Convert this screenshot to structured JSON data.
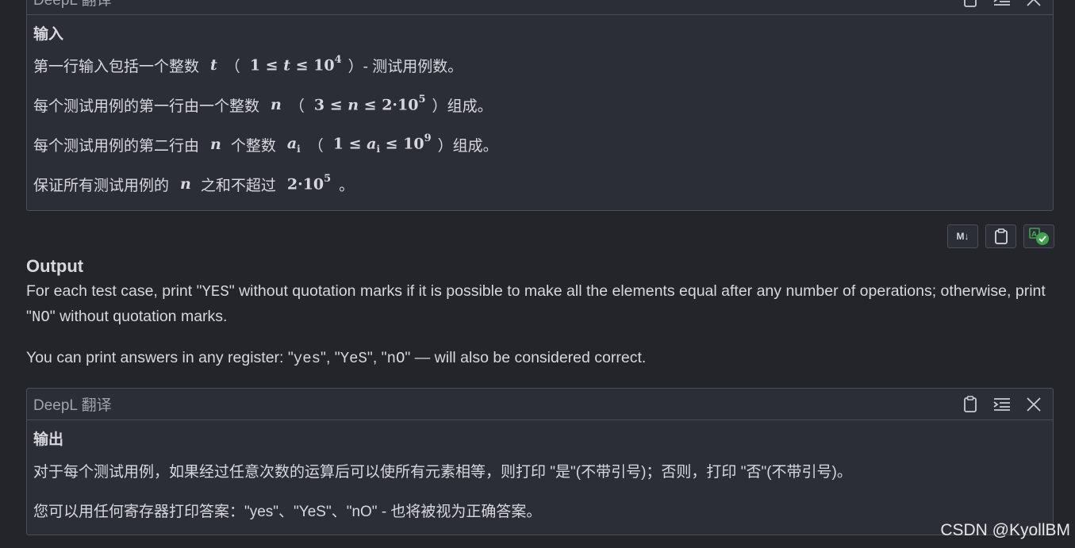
{
  "top_panel": {
    "title": "DeepL 翻译",
    "heading": "输入",
    "lines": [
      {
        "pre": "第一行输入包括一个整数",
        "var": "t",
        "open": "（",
        "expr_left": "1 ≤ ",
        "expr_var": "t",
        "expr_mid": " ≤ 10",
        "sup": "4",
        "close": "）",
        "post": "- 测试用例数。"
      },
      {
        "pre": "每个测试用例的第一行由一个整数",
        "var": "n",
        "open": "（",
        "expr_left": "3 ≤ ",
        "expr_var": "n",
        "expr_mid": " ≤ 2·10",
        "sup": "5",
        "close": "）",
        "post": "组成。"
      },
      {
        "pre": "每个测试用例的第二行由",
        "var": "n",
        "mid_text": "个整数",
        "var2": "a",
        "var2_sub": "i",
        "open": "（",
        "expr_left": "1 ≤ ",
        "expr_var": "a",
        "expr_var_sub": "i",
        "expr_mid": " ≤ 10",
        "sup": "9",
        "close": "）",
        "post": "组成。"
      },
      {
        "pre": "保证所有测试用例的",
        "var": "n",
        "mid_text": "之和不超过",
        "expr_mid": "2·10",
        "sup": "5",
        "post": "。"
      }
    ]
  },
  "toolbar": {
    "buttons": [
      {
        "label": "M↓",
        "icon": "markdown-icon"
      },
      {
        "icon": "clipboard-icon"
      },
      {
        "icon": "translate-check-icon"
      }
    ]
  },
  "output_section": {
    "title": "Output",
    "p1_pre": "For each test case, print \"",
    "p1_code1": "YES",
    "p1_mid": "\" without quotation marks if it is possible to make all the elements equal after any number of operations; otherwise, print \"",
    "p1_code2": "NO",
    "p1_post": "\" without quotation marks.",
    "p2_pre": "You can print answers in any register: \"",
    "p2_code1": "yes",
    "p2_sep1": "\", \"",
    "p2_code2": "YeS",
    "p2_sep2": "\", \"",
    "p2_code3": "nO",
    "p2_post": "\" — will also be considered correct."
  },
  "bottom_panel": {
    "title": "DeepL 翻译",
    "heading": "输出",
    "line1": "对于每个测试用例，如果经过任意次数的运算后可以使所有元素相等，则打印 \"是\"(不带引号)；否则，打印 \"否\"(不带引号)。",
    "line2": "您可以用任何寄存器打印答案：\"yes\"、\"YeS\"、\"nO\" - 也将被视为正确答案。"
  },
  "watermark": "CSDN @KyollBM",
  "colors": {
    "background": "#23252b",
    "panel": "#2b2e36",
    "border": "#4a4e58",
    "text": "#d6d8dd",
    "accent_green": "#3fa34d"
  }
}
